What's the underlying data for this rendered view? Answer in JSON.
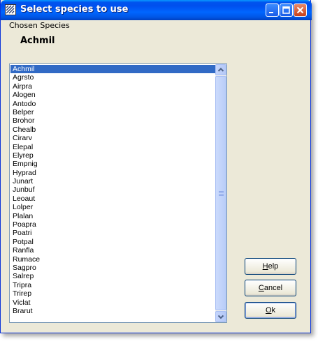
{
  "window": {
    "title": "Select species to use"
  },
  "chosen": {
    "label": "Chosen Species",
    "value": "Achmil"
  },
  "species_list": {
    "selected_index": 0,
    "items": [
      "Achmil",
      "Agrsto",
      "Airpra",
      "Alogen",
      "Antodo",
      "Belper",
      "Brohor",
      "Chealb",
      "Cirarv",
      "Elepal",
      "Elyrep",
      "Empnig",
      "Hyprad",
      "Junart",
      "Junbuf",
      "Leoaut",
      "Lolper",
      "Plalan",
      "Poapra",
      "Poatri",
      "Potpal",
      "Ranfla",
      "Rumace",
      "Sagpro",
      "Salrep",
      "Tripra",
      "Trirep",
      "Viclat",
      "Brarut"
    ]
  },
  "buttons": {
    "help": {
      "mnemonic": "H",
      "rest": "elp"
    },
    "cancel": {
      "mnemonic": "C",
      "rest": "ancel"
    },
    "ok": {
      "mnemonic": "O",
      "rest": "k"
    }
  },
  "colors": {
    "selection": "#316ac5",
    "dialog_bg": "#ece9d8",
    "titlebar": "#0055e5"
  }
}
